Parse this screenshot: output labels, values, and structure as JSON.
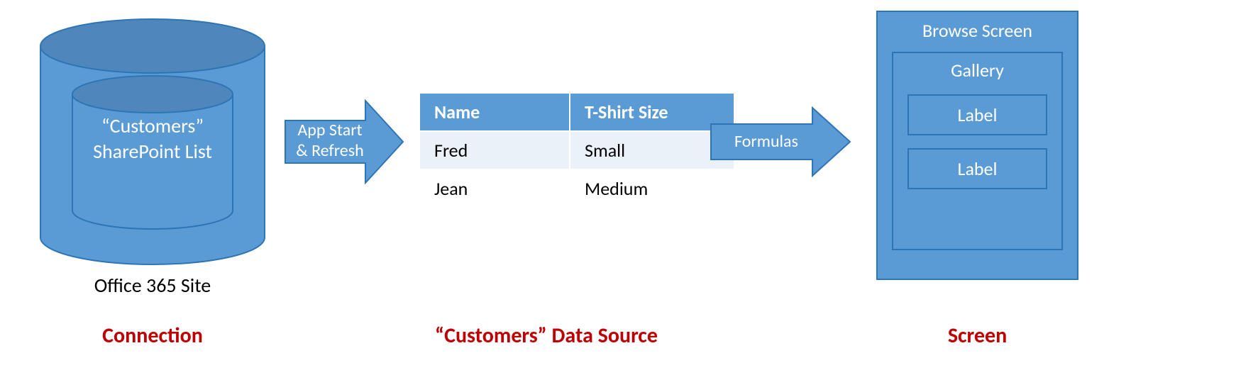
{
  "connection": {
    "inner_label_line1": "“Customers”",
    "inner_label_line2": "SharePoint List",
    "site_label": "Office 365 Site",
    "caption": "Connection"
  },
  "arrow1": {
    "label_line1": "App Start",
    "label_line2": "& Refresh"
  },
  "arrow2": {
    "label": "Formulas"
  },
  "data_source": {
    "caption": "“Customers” Data Source",
    "columns": {
      "name": "Name",
      "size": "T-Shirt Size"
    },
    "rows": [
      {
        "name": "Fred",
        "size": "Small"
      },
      {
        "name": "Jean",
        "size": "Medium"
      }
    ]
  },
  "screen": {
    "title": "Browse Screen",
    "gallery": "Gallery",
    "label1": "Label",
    "label2": "Label",
    "caption": "Screen"
  },
  "colors": {
    "shape_fill": "#5B9BD5",
    "shape_stroke": "#2E75B6",
    "cyl_face": "#4F87BC",
    "caption_red": "#C00000"
  }
}
